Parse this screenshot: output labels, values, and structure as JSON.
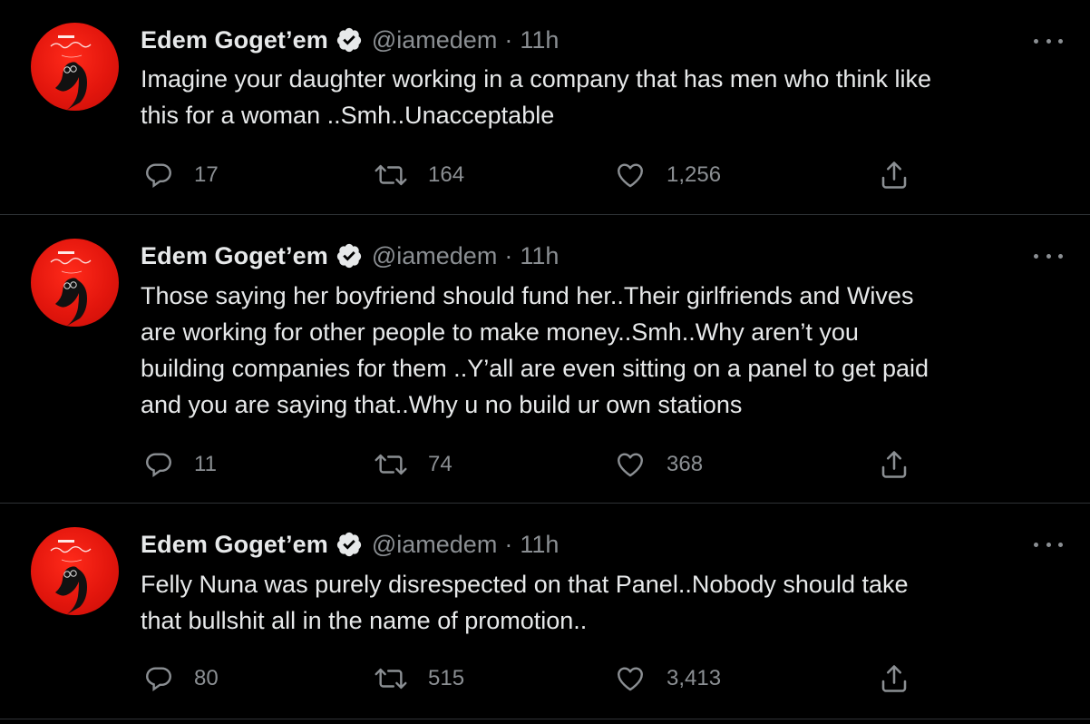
{
  "tweets": [
    {
      "display_name": "Edem Goget’em",
      "handle": "@iamedem",
      "separator": "·",
      "time": "11h",
      "text": "Imagine your daughter working in a company that has men who think like\nthis for a woman ..Smh..Unacceptable",
      "replies": "17",
      "retweets": "164",
      "likes": "1,256",
      "avatar_icon": "profile-avatar-red",
      "verified_icon": "verified-badge"
    },
    {
      "display_name": "Edem Goget’em",
      "handle": "@iamedem",
      "separator": "·",
      "time": "11h",
      "text": "Those saying her boyfriend should fund her..Their girlfriends and Wives\nare working for other people to make money..Smh..Why aren’t you\nbuilding companies for them ..Y’all are even sitting on a panel to get paid\nand you are saying that..Why u no build ur own stations",
      "replies": "11",
      "retweets": "74",
      "likes": "368",
      "avatar_icon": "profile-avatar-red",
      "verified_icon": "verified-badge"
    },
    {
      "display_name": "Edem Goget’em",
      "handle": "@iamedem",
      "separator": "·",
      "time": "11h",
      "text": "Felly Nuna was purely disrespected on that Panel..Nobody should take\nthat bullshit all in the name of promotion..",
      "replies": "80",
      "retweets": "515",
      "likes": "3,413",
      "avatar_icon": "profile-avatar-red",
      "verified_icon": "verified-badge"
    }
  ],
  "colors": {
    "background": "#000000",
    "text_primary": "#e7e9ea",
    "text_secondary": "#8b8f93",
    "divider": "#2f3336",
    "avatar_red": "#e3160d"
  },
  "icons": {
    "reply": "reply-icon",
    "retweet": "retweet-icon",
    "like": "heart-icon",
    "share": "share-icon",
    "more": "more-options-icon"
  }
}
